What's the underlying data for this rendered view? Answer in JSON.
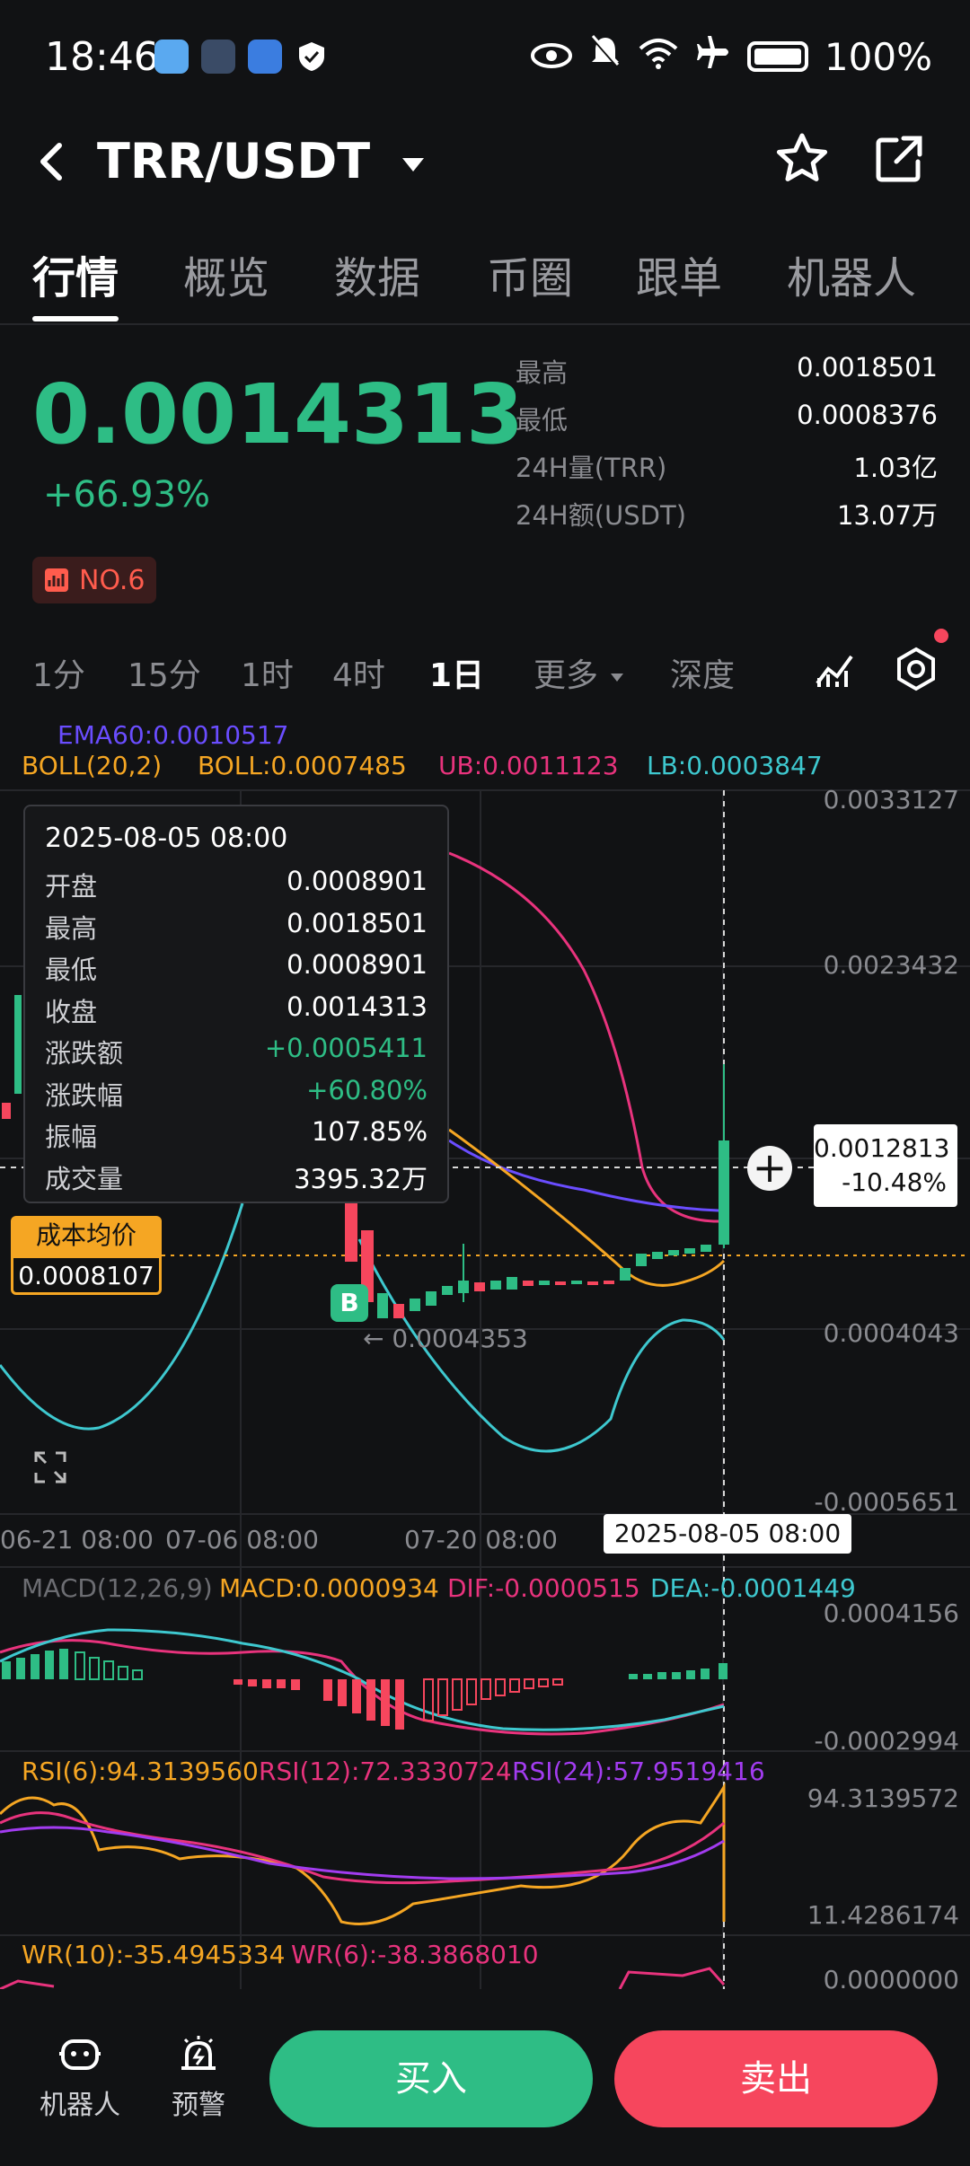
{
  "status": {
    "time": "18:46",
    "battery": "100%"
  },
  "header": {
    "pair": "TRR/USDT"
  },
  "tabs": [
    "行情",
    "概览",
    "数据",
    "币圈",
    "跟单",
    "机器人"
  ],
  "ticker": {
    "price": "0.0014313",
    "change_pct": "+66.93%",
    "rank": "NO.6"
  },
  "stats": [
    {
      "k": "最高",
      "v": "0.0018501"
    },
    {
      "k": "最低",
      "v": "0.0008376"
    },
    {
      "k": "24H量(TRR)",
      "v": "1.03亿"
    },
    {
      "k": "24H额(USDT)",
      "v": "13.07万"
    }
  ],
  "intervals": [
    "1分",
    "15分",
    "1时",
    "4时",
    "1日",
    "更多",
    "深度"
  ],
  "indicators": {
    "ema": "EMA60:0.0010517",
    "boll_name": "BOLL(20,2)",
    "boll": "BOLL:0.0007485",
    "ub": "UB:0.0011123",
    "lb": "LB:0.0003847",
    "macd_name": "MACD(12,26,9)",
    "macd": "MACD:0.0000934",
    "dif": "DIF:-0.0000515",
    "dea": "DEA:-0.0001449",
    "rsi6": "RSI(6):94.3139560",
    "rsi12": "RSI(12):72.3330724",
    "rsi24": "RSI(24):57.9519416",
    "wr10": "WR(10):-35.4945334",
    "wr6": "WR(6):-38.3868010"
  },
  "axis": {
    "main": [
      "0.0033127",
      "0.0023432",
      "0.0004043",
      "-0.0005651"
    ],
    "macd": [
      "0.0004156",
      "-0.0002994"
    ],
    "rsi": [
      "94.3139572",
      "11.4286174"
    ],
    "wr": [
      "0.0000000"
    ]
  },
  "x_labels": [
    "06-21 08:00",
    "07-06 08:00",
    "07-20 08:00"
  ],
  "tooltip": {
    "date": "2025-08-05 08:00",
    "rows": [
      {
        "k": "开盘",
        "v": "0.0008901"
      },
      {
        "k": "最高",
        "v": "0.0018501"
      },
      {
        "k": "最低",
        "v": "0.0008901"
      },
      {
        "k": "收盘",
        "v": "0.0014313"
      },
      {
        "k": "涨跌额",
        "v": "+0.0005411"
      },
      {
        "k": "涨跌幅",
        "v": "+60.80%"
      },
      {
        "k": "振幅",
        "v": "107.85%"
      },
      {
        "k": "成交量",
        "v": "3395.32万"
      }
    ]
  },
  "cost": {
    "label": "成本均价",
    "value": "0.0008107"
  },
  "crosshair": {
    "price": "0.0012813",
    "pct": "-10.48%",
    "date": "2025-08-05 08:00"
  },
  "low_marker": "← 0.0004353",
  "buy_marker": "B",
  "bottom": {
    "robot": "机器人",
    "alert": "预警",
    "buy": "买入",
    "sell": "卖出"
  },
  "colors": {
    "up": "#2ebd85",
    "down": "#f6465d",
    "boll": "#f5a623",
    "ub": "#e8337d",
    "lb": "#3ec8cf",
    "ema": "#6a4dff"
  }
}
